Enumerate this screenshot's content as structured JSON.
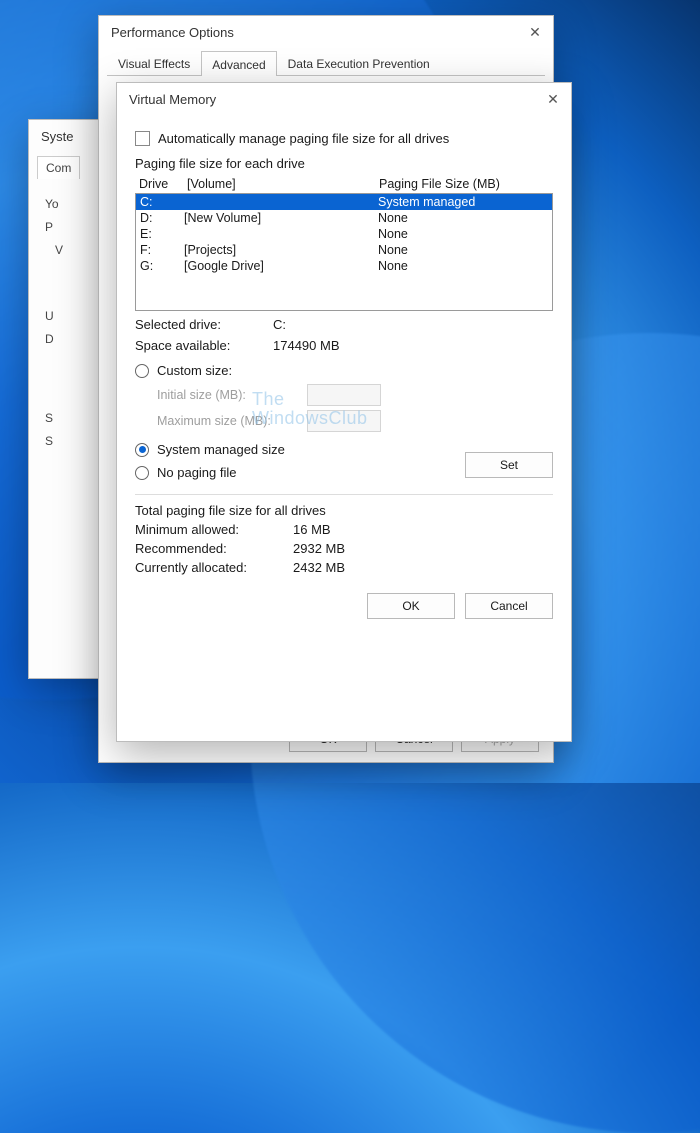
{
  "sysprop": {
    "title": "Syste",
    "tab": "Com",
    "lines": [
      "Yo",
      "P",
      "V",
      "",
      "U",
      "D",
      "",
      "S",
      "S"
    ]
  },
  "perf": {
    "title": "Performance Options",
    "tabs": {
      "visual": "Visual Effects",
      "advanced": "Advanced",
      "dep": "Data Execution Prevention"
    },
    "buttons": {
      "ok": "OK",
      "cancel": "Cancel",
      "apply": "Apply"
    }
  },
  "vm": {
    "title": "Virtual Memory",
    "auto_manage": "Automatically manage paging file size for all drives",
    "fs_each": "Paging file size for each drive",
    "head": {
      "drive": "Drive",
      "volume": "[Volume]",
      "pfs": "Paging File Size (MB)"
    },
    "drives": [
      {
        "d": "C:",
        "v": "",
        "p": "System managed",
        "sel": true
      },
      {
        "d": "D:",
        "v": "[New Volume]",
        "p": "None",
        "sel": false
      },
      {
        "d": "E:",
        "v": "",
        "p": "None",
        "sel": false
      },
      {
        "d": "F:",
        "v": "[Projects]",
        "p": "None",
        "sel": false
      },
      {
        "d": "G:",
        "v": "[Google Drive]",
        "p": "None",
        "sel": false
      }
    ],
    "selected_drive_label": "Selected drive:",
    "selected_drive": "C:",
    "space_label": "Space available:",
    "space": "174490 MB",
    "custom": "Custom size:",
    "initial": "Initial size (MB):",
    "maximum": "Maximum size (MB):",
    "sysmgd": "System managed size",
    "nopf": "No paging file",
    "set": "Set",
    "totals_legend": "Total paging file size for all drives",
    "min_label": "Minimum allowed:",
    "min": "16 MB",
    "rec_label": "Recommended:",
    "rec": "2932 MB",
    "cur_label": "Currently allocated:",
    "cur": "2432 MB",
    "ok": "OK",
    "cancel": "Cancel"
  },
  "watermark": {
    "l1": "The",
    "l2": "WindowsClub"
  }
}
